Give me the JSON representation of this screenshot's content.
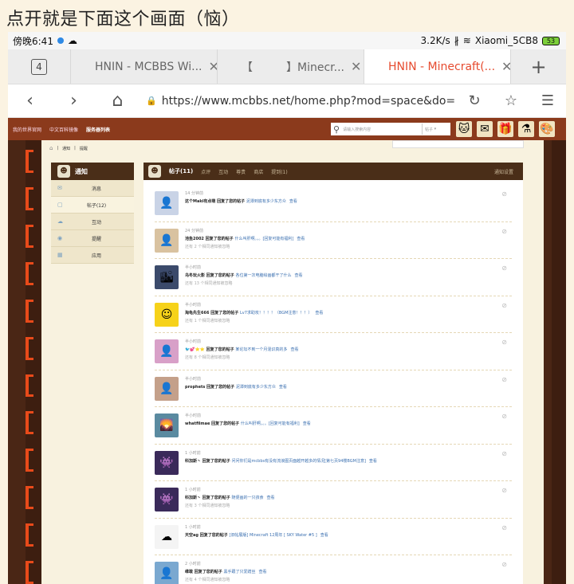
{
  "caption": "点开就是下面这个画面（恼）",
  "status": {
    "time": "傍晚6:41",
    "speed": "3.2K/s",
    "bt": "∦",
    "wifi_name": "Xiaomi_5CB8",
    "battery": "53"
  },
  "tabs": {
    "count": "4",
    "items": [
      {
        "label": "HNIN - MCBBS Wi...",
        "close": "✕"
      },
      {
        "label": "【　　　】Minecr...",
        "close": "✕"
      },
      {
        "label": "HNIN - Minecraft(...",
        "close": "✕"
      }
    ],
    "plus": "+"
  },
  "address": {
    "back": "‹",
    "forward": "›",
    "home": "⌂",
    "lock": "🔒",
    "url": "https://www.mcbbs.net/home.php?mod=space&do=notice&",
    "reload": "↻",
    "star": "☆",
    "menu": "☰"
  },
  "site": {
    "nav_links": [
      "我的世界官网",
      "中文百科镜像",
      "服务器列表"
    ],
    "search_placeholder": "请输入搜索内容",
    "search_select": "帖子",
    "crumbs": [
      "通知",
      "提醒"
    ],
    "sidebar_title": "通知",
    "sidebar_items": [
      {
        "icon": "✉",
        "label": "消息"
      },
      {
        "icon": "▢",
        "label": "帖子(12)"
      },
      {
        "icon": "☁",
        "label": "互动"
      },
      {
        "icon": "◉",
        "label": "提醒"
      },
      {
        "icon": "▦",
        "label": "应用"
      }
    ],
    "main_tabs": [
      "帖子(11)",
      "点评",
      "互动",
      "尊贵",
      "商店",
      "提到(1)"
    ],
    "settings": "通知设置"
  },
  "notices": [
    {
      "time": "14 分钟前",
      "user": "这个Maki有点萌",
      "action": "回复了您的帖子",
      "post": "泥潭到底有多少东方众",
      "view": "查看",
      "extra": "",
      "thumb_color": "#c9d3e6",
      "thumb_glyph": "👤"
    },
    {
      "time": "24 分钟前",
      "user": "池鱼2002",
      "action": "回复了您的帖子",
      "post": "什么叫肝啊。。。[回复可能有福利]",
      "view": "查看",
      "extra": "还有 2 个相同通知被忽略",
      "thumb_color": "#d9c2a0",
      "thumb_glyph": "👤"
    },
    {
      "time": "半小时前",
      "user": "乌冬玩火影",
      "action": "回复了您的帖子",
      "post": "各位第一次电脑绘画都干了什么",
      "view": "查看",
      "extra": "还有 13 个相同通知被忽略",
      "thumb_color": "#3b4a6b",
      "thumb_glyph": "🏙"
    },
    {
      "time": "半小时前",
      "user": "淘龟先生666",
      "action": "回复了您的帖子",
      "post": "Lv7求助攻！！！！（BGM注意！！！）",
      "view": "查看",
      "extra": "还有 1 个相同通知被忽略",
      "thumb_color": "#f6d21a",
      "thumb_glyph": "☺"
    },
    {
      "time": "半小时前",
      "user": "🐦💕⭐⭐",
      "action": "回复了您的帖子",
      "post": "某论坛不到一个月混识真的多",
      "view": "查看",
      "extra": "还有 8 个相同通知被忽略",
      "thumb_color": "#d8a0c8",
      "thumb_glyph": "👤"
    },
    {
      "time": "半小时前",
      "user": "prophets",
      "action": "回复了您的帖子",
      "post": "泥潭到底有多少东方众",
      "view": "查看",
      "extra": "",
      "thumb_color": "#c4a08a",
      "thumb_glyph": "👤"
    },
    {
      "time": "半小时前",
      "user": "whatfilmae",
      "action": "回复了您的帖子",
      "post": "什么叫肝啊。。。[回复可能有福利]",
      "view": "查看",
      "extra": "",
      "thumb_color": "#5a8aa0",
      "thumb_glyph": "🌄"
    },
    {
      "time": "1 小时前",
      "user": "科加斯丶",
      "action": "回复了您的帖子",
      "post": "问问你们是mcbbs有没有流浪图页面越开越多的情况[第七页94楼BGM注意]",
      "view": "查看",
      "extra": "",
      "thumb_color": "#3a2a5a",
      "thumb_glyph": "👾"
    },
    {
      "time": "1 小时前",
      "user": "科加斯丶",
      "action": "回复了您的帖子",
      "post": "随便画的一只孩食",
      "view": "查看",
      "extra": "还有 3 个相同通知被忽略",
      "thumb_color": "#3a2a5a",
      "thumb_glyph": "👾"
    },
    {
      "time": "1 小时前",
      "user": "天空ag",
      "action": "回复了您的帖子",
      "post": "[旧帖展版] Minecraft 12周年 [ SKY Water #5 ]",
      "view": "查看",
      "extra": "",
      "thumb_color": "#f4f4f4",
      "thumb_glyph": "☁"
    },
    {
      "time": "2 小时前",
      "user": "维敢",
      "action": "回复了您的帖子",
      "post": "黑手跟了只爱蹭丝",
      "view": "查看",
      "extra": "还有 4 个相同通知被忽略",
      "thumb_color": "#7aa8d0",
      "thumb_glyph": "👤"
    }
  ]
}
